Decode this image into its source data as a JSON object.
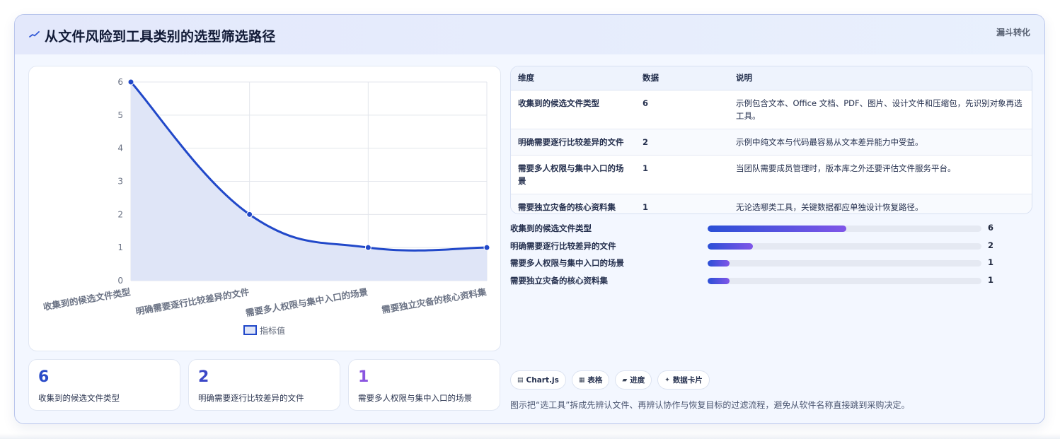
{
  "header": {
    "title": "从文件风险到工具类别的选型筛选路径",
    "tag": "漏斗转化"
  },
  "chart_data": {
    "type": "line",
    "categories": [
      "收集到的候选文件类型",
      "明确需要逐行比较差异的文件",
      "需要多人权限与集中入口的场景",
      "需要独立灾备的核心资料集"
    ],
    "series": [
      {
        "name": "指标值",
        "values": [
          6,
          2,
          1,
          1
        ]
      }
    ],
    "ylim": [
      0,
      6
    ],
    "yticks": [
      0,
      1,
      2,
      3,
      4,
      5,
      6
    ],
    "grid": true,
    "fill": true,
    "smooth": true,
    "legend_position": "bottom",
    "line_color": "#2148c9",
    "fill_color": "#dfe5f7"
  },
  "table": {
    "headers": [
      "维度",
      "数据",
      "说明"
    ],
    "rows": [
      [
        "收集到的候选文件类型",
        "6",
        "示例包含文本、Office 文档、PDF、图片、设计文件和压缩包，先识别对象再选工具。"
      ],
      [
        "明确需要逐行比较差异的文件",
        "2",
        "示例中纯文本与代码最容易从文本差异能力中受益。"
      ],
      [
        "需要多人权限与集中入口的场景",
        "1",
        "当团队需要成员管理时，版本库之外还要评估文件服务平台。"
      ],
      [
        "需要独立灾备的核心资料集",
        "1",
        "无论选哪类工具，关键数据都应单独设计恢复路径。"
      ]
    ]
  },
  "bars": [
    {
      "label": "收集到的候选文件类型",
      "value": 6,
      "fraction": 0.506
    },
    {
      "label": "明确需要逐行比较差异的文件",
      "value": 2,
      "fraction": 0.165
    },
    {
      "label": "需要多人权限与集中入口的场景",
      "value": 1,
      "fraction": 0.08
    },
    {
      "label": "需要独立灾备的核心资料集",
      "value": 1,
      "fraction": 0.08
    }
  ],
  "stats": [
    {
      "value": "6",
      "label": "收集到的候选文件类型",
      "color": "#2a4bc8"
    },
    {
      "value": "2",
      "label": "明确需要逐行比较差异的文件",
      "color": "#3b47c7"
    },
    {
      "value": "1",
      "label": "需要多人权限与集中入口的场景",
      "color": "#8a55e0"
    }
  ],
  "chips": [
    {
      "icon": "chart-icon",
      "glyph": "▤",
      "label": "Chart.js"
    },
    {
      "icon": "table-icon",
      "glyph": "▦",
      "label": "表格"
    },
    {
      "icon": "progress-icon",
      "glyph": "▰",
      "label": "进度"
    },
    {
      "icon": "sparkle-icon",
      "glyph": "✦",
      "label": "数据卡片"
    }
  ],
  "footnote": "图示把“选工具”拆成先辨认文件、再辨认协作与恢复目标的过滤流程，避免从软件名称直接跳到采购决定。"
}
